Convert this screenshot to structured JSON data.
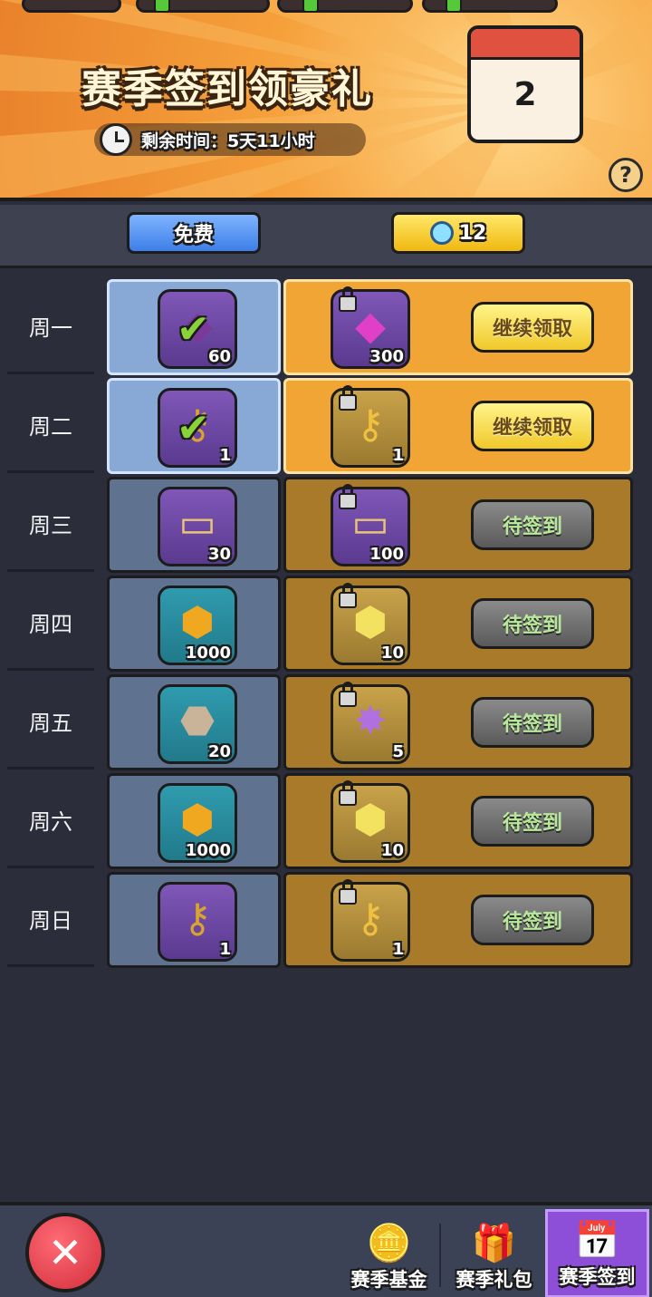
{
  "header": {
    "title": "赛季签到领豪礼",
    "timer_text": "剩余时间：5天11小时",
    "calendar_day": "2",
    "help_label": "?"
  },
  "tabs": {
    "free_label": "免费",
    "premium_cost": "12"
  },
  "rows": [
    {
      "day": "周一",
      "free": {
        "icon": "purple-gem-icon",
        "qty": "60",
        "claimed": true
      },
      "premium": {
        "icon": "pink-gem-icon",
        "qty": "300",
        "button": "继续领取",
        "state": "claimable"
      }
    },
    {
      "day": "周二",
      "free": {
        "icon": "key-icon",
        "qty": "1",
        "claimed": true
      },
      "premium": {
        "icon": "golden-key-icon",
        "qty": "1",
        "button": "继续领取",
        "state": "claimable"
      }
    },
    {
      "day": "周三",
      "free": {
        "icon": "ticket-icon",
        "qty": "30",
        "claimed": false
      },
      "premium": {
        "icon": "ticket-icon",
        "qty": "100",
        "button": "待签到",
        "state": "waiting"
      }
    },
    {
      "day": "周四",
      "free": {
        "icon": "gold-coin-icon",
        "qty": "1000",
        "claimed": false
      },
      "premium": {
        "icon": "yellow-crystal-icon",
        "qty": "10",
        "button": "待签到",
        "state": "waiting"
      }
    },
    {
      "day": "周五",
      "free": {
        "icon": "rune-stone-icon",
        "qty": "20",
        "claimed": false
      },
      "premium": {
        "icon": "purple-shard-icon",
        "qty": "5",
        "button": "待签到",
        "state": "waiting"
      }
    },
    {
      "day": "周六",
      "free": {
        "icon": "gold-coin-icon",
        "qty": "1000",
        "claimed": false
      },
      "premium": {
        "icon": "yellow-crystal-icon",
        "qty": "10",
        "button": "待签到",
        "state": "waiting"
      }
    },
    {
      "day": "周日",
      "free": {
        "icon": "key-icon",
        "qty": "1",
        "claimed": false
      },
      "premium": {
        "icon": "golden-key-icon",
        "qty": "1",
        "button": "待签到",
        "state": "waiting"
      }
    }
  ],
  "bottom_nav": {
    "close_label": "✕",
    "items": [
      {
        "label": "赛季基金",
        "icon": "coin-gem-icon"
      },
      {
        "label": "赛季礼包",
        "icon": "gift-chest-icon"
      },
      {
        "label": "赛季签到",
        "icon": "calendar-check-icon",
        "selected": true
      }
    ]
  },
  "colors": {
    "header_orange": "#f6a13c",
    "claim_button": "#f0c82a",
    "selected_tab": "#8e4fd8"
  }
}
